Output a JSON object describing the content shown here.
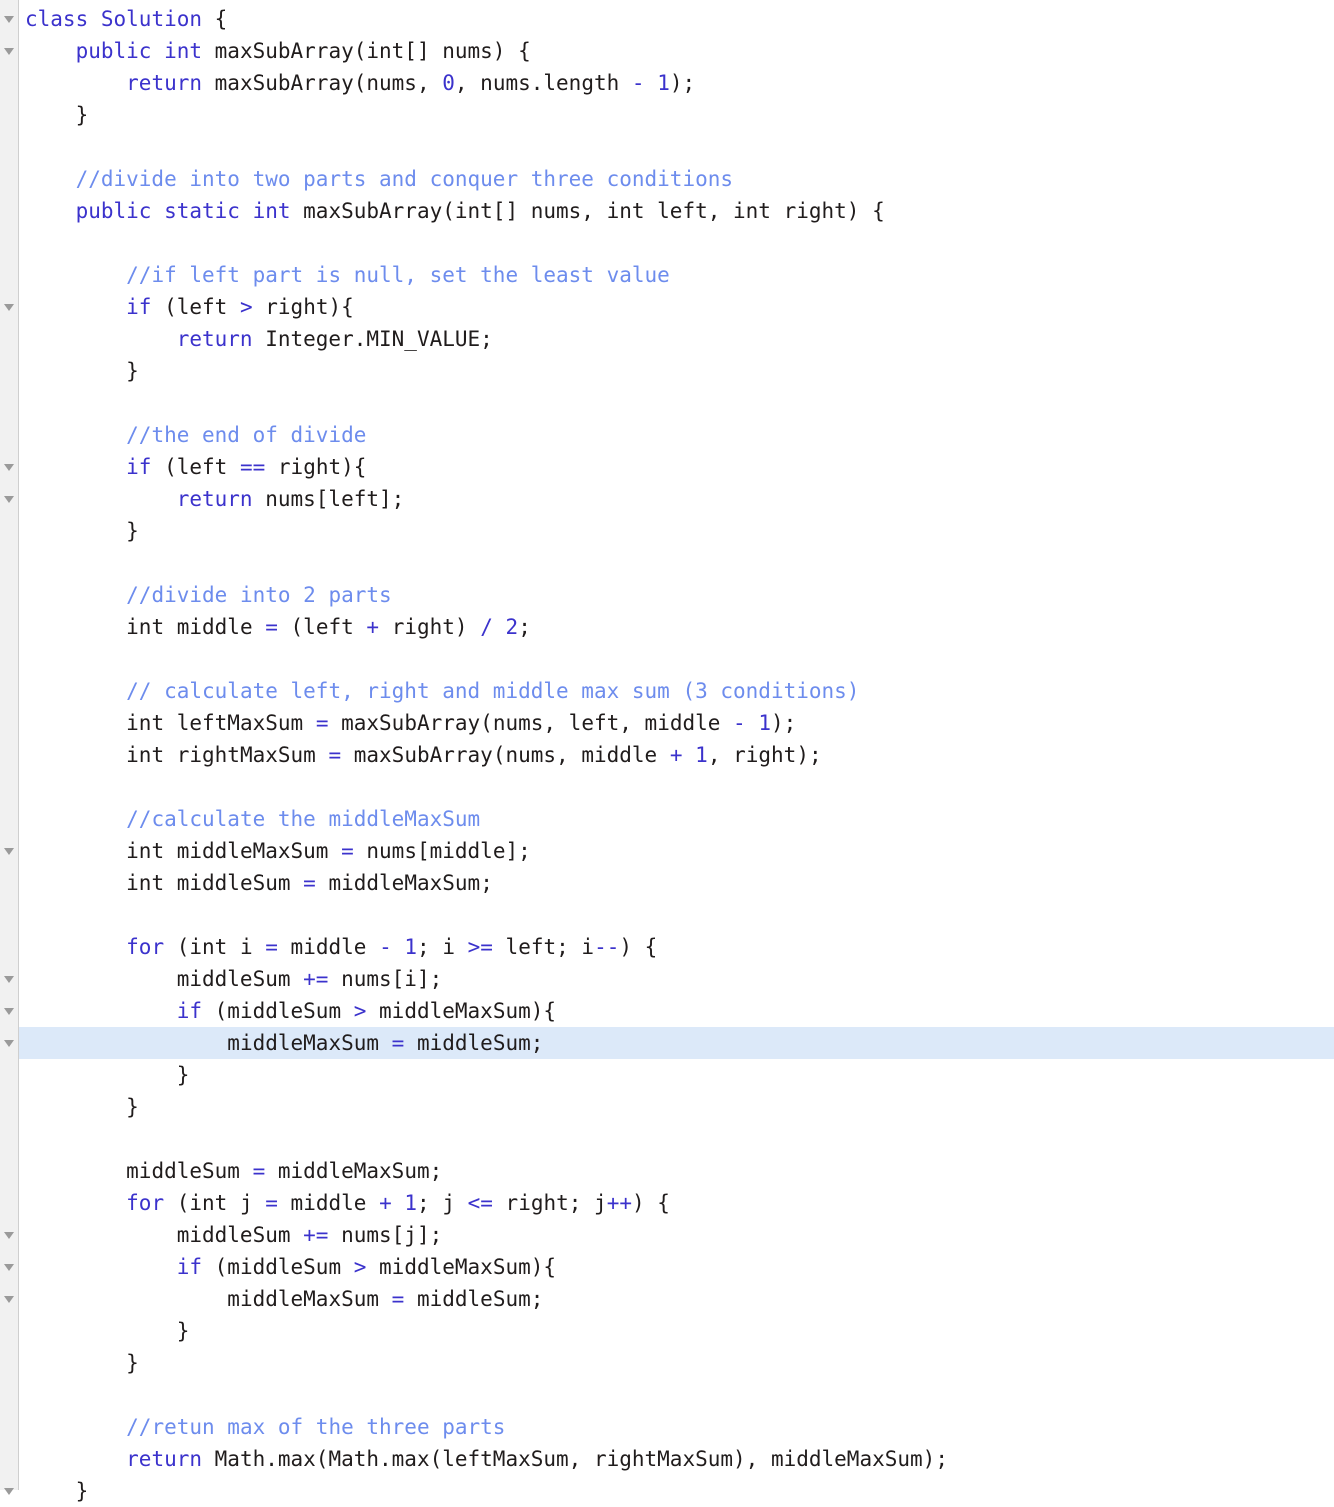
{
  "editor": {
    "language": "java",
    "gutter_label": "code-folding-gutter",
    "highlighted_line_index": 32,
    "line_height_px": 32,
    "colors": {
      "background": "#ffffff",
      "gutter_background": "#f1f1f1",
      "gutter_separator": "#cfcfcf",
      "keyword": "#3b32cc",
      "comment": "#6d8ced",
      "plain": "#201c1c",
      "operator": "#3b32cc",
      "number": "#3b32cc",
      "current_line_highlight": "#dce9f9",
      "fold_arrow": "#9a9a9a"
    },
    "fold_arrow_lines": [
      0,
      1,
      9,
      14,
      15,
      26,
      30,
      31,
      32,
      38,
      39,
      40,
      46
    ],
    "lines": [
      {
        "indent": 0,
        "tokens": [
          {
            "t": "kw",
            "v": "class"
          },
          {
            "t": "pl",
            "v": " "
          },
          {
            "t": "kw",
            "v": "Solution"
          },
          {
            "t": "pl",
            "v": " {"
          }
        ]
      },
      {
        "indent": 1,
        "tokens": [
          {
            "t": "kw",
            "v": "public int"
          },
          {
            "t": "pl",
            "v": " maxSubArray(int[] nums) {"
          }
        ]
      },
      {
        "indent": 2,
        "tokens": [
          {
            "t": "kw",
            "v": "return"
          },
          {
            "t": "pl",
            "v": " maxSubArray(nums, "
          },
          {
            "t": "num",
            "v": "0"
          },
          {
            "t": "pl",
            "v": ", nums.length "
          },
          {
            "t": "op",
            "v": "-"
          },
          {
            "t": "pl",
            "v": " "
          },
          {
            "t": "num",
            "v": "1"
          },
          {
            "t": "pl",
            "v": ");"
          }
        ]
      },
      {
        "indent": 1,
        "tokens": [
          {
            "t": "pl",
            "v": "}"
          }
        ]
      },
      {
        "indent": 0,
        "tokens": []
      },
      {
        "indent": 1,
        "tokens": [
          {
            "t": "cmt",
            "v": "//divide into two parts and conquer three conditions"
          }
        ]
      },
      {
        "indent": 1,
        "tokens": [
          {
            "t": "kw",
            "v": "public static int"
          },
          {
            "t": "pl",
            "v": " maxSubArray(int[] nums, int left, int right) {"
          }
        ]
      },
      {
        "indent": 0,
        "tokens": []
      },
      {
        "indent": 2,
        "tokens": [
          {
            "t": "cmt",
            "v": "//if left part is null, set the least value"
          }
        ]
      },
      {
        "indent": 2,
        "tokens": [
          {
            "t": "kw",
            "v": "if"
          },
          {
            "t": "pl",
            "v": " (left "
          },
          {
            "t": "op",
            "v": ">"
          },
          {
            "t": "pl",
            "v": " right){"
          }
        ]
      },
      {
        "indent": 3,
        "tokens": [
          {
            "t": "kw",
            "v": "return"
          },
          {
            "t": "pl",
            "v": " Integer.MIN_VALUE;"
          }
        ]
      },
      {
        "indent": 2,
        "tokens": [
          {
            "t": "pl",
            "v": "}"
          }
        ]
      },
      {
        "indent": 0,
        "tokens": []
      },
      {
        "indent": 2,
        "tokens": [
          {
            "t": "cmt",
            "v": "//the end of divide"
          }
        ]
      },
      {
        "indent": 2,
        "tokens": [
          {
            "t": "kw",
            "v": "if"
          },
          {
            "t": "pl",
            "v": " (left "
          },
          {
            "t": "op",
            "v": "=="
          },
          {
            "t": "pl",
            "v": " right){"
          }
        ]
      },
      {
        "indent": 3,
        "tokens": [
          {
            "t": "kw",
            "v": "return"
          },
          {
            "t": "pl",
            "v": " nums[left];"
          }
        ]
      },
      {
        "indent": 2,
        "tokens": [
          {
            "t": "pl",
            "v": "}"
          }
        ]
      },
      {
        "indent": 0,
        "tokens": []
      },
      {
        "indent": 2,
        "tokens": [
          {
            "t": "cmt",
            "v": "//divide into 2 parts"
          }
        ]
      },
      {
        "indent": 2,
        "tokens": [
          {
            "t": "pl",
            "v": "int middle "
          },
          {
            "t": "op",
            "v": "="
          },
          {
            "t": "pl",
            "v": " (left "
          },
          {
            "t": "op",
            "v": "+"
          },
          {
            "t": "pl",
            "v": " right) "
          },
          {
            "t": "op",
            "v": "/"
          },
          {
            "t": "pl",
            "v": " "
          },
          {
            "t": "num",
            "v": "2"
          },
          {
            "t": "pl",
            "v": ";"
          }
        ]
      },
      {
        "indent": 0,
        "tokens": []
      },
      {
        "indent": 2,
        "tokens": [
          {
            "t": "cmt",
            "v": "// calculate left, right and middle max sum (3 conditions)"
          }
        ]
      },
      {
        "indent": 2,
        "tokens": [
          {
            "t": "pl",
            "v": "int leftMaxSum "
          },
          {
            "t": "op",
            "v": "="
          },
          {
            "t": "pl",
            "v": " maxSubArray(nums, left, middle "
          },
          {
            "t": "op",
            "v": "-"
          },
          {
            "t": "pl",
            "v": " "
          },
          {
            "t": "num",
            "v": "1"
          },
          {
            "t": "pl",
            "v": ");"
          }
        ]
      },
      {
        "indent": 2,
        "tokens": [
          {
            "t": "pl",
            "v": "int rightMaxSum "
          },
          {
            "t": "op",
            "v": "="
          },
          {
            "t": "pl",
            "v": " maxSubArray(nums, middle "
          },
          {
            "t": "op",
            "v": "+"
          },
          {
            "t": "pl",
            "v": " "
          },
          {
            "t": "num",
            "v": "1"
          },
          {
            "t": "pl",
            "v": ", right);"
          }
        ]
      },
      {
        "indent": 0,
        "tokens": []
      },
      {
        "indent": 2,
        "tokens": [
          {
            "t": "cmt",
            "v": "//calculate the middleMaxSum"
          }
        ]
      },
      {
        "indent": 2,
        "tokens": [
          {
            "t": "pl",
            "v": "int middleMaxSum "
          },
          {
            "t": "op",
            "v": "="
          },
          {
            "t": "pl",
            "v": " nums[middle];"
          }
        ]
      },
      {
        "indent": 2,
        "tokens": [
          {
            "t": "pl",
            "v": "int middleSum "
          },
          {
            "t": "op",
            "v": "="
          },
          {
            "t": "pl",
            "v": " middleMaxSum;"
          }
        ]
      },
      {
        "indent": 0,
        "tokens": []
      },
      {
        "indent": 2,
        "tokens": [
          {
            "t": "kw",
            "v": "for"
          },
          {
            "t": "pl",
            "v": " (int i "
          },
          {
            "t": "op",
            "v": "="
          },
          {
            "t": "pl",
            "v": " middle "
          },
          {
            "t": "op",
            "v": "-"
          },
          {
            "t": "pl",
            "v": " "
          },
          {
            "t": "num",
            "v": "1"
          },
          {
            "t": "pl",
            "v": "; i "
          },
          {
            "t": "op",
            "v": ">="
          },
          {
            "t": "pl",
            "v": " left; i"
          },
          {
            "t": "op",
            "v": "--"
          },
          {
            "t": "pl",
            "v": ") {"
          }
        ]
      },
      {
        "indent": 3,
        "tokens": [
          {
            "t": "pl",
            "v": "middleSum "
          },
          {
            "t": "op",
            "v": "+="
          },
          {
            "t": "pl",
            "v": " nums[i];"
          }
        ]
      },
      {
        "indent": 3,
        "tokens": [
          {
            "t": "kw",
            "v": "if"
          },
          {
            "t": "pl",
            "v": " (middleSum "
          },
          {
            "t": "op",
            "v": ">"
          },
          {
            "t": "pl",
            "v": " middleMaxSum){"
          }
        ]
      },
      {
        "indent": 4,
        "tokens": [
          {
            "t": "pl",
            "v": "middleMaxSum "
          },
          {
            "t": "op",
            "v": "="
          },
          {
            "t": "pl",
            "v": " middleSum;"
          }
        ]
      },
      {
        "indent": 3,
        "tokens": [
          {
            "t": "pl",
            "v": "}"
          }
        ]
      },
      {
        "indent": 2,
        "tokens": [
          {
            "t": "pl",
            "v": "}"
          }
        ]
      },
      {
        "indent": 0,
        "tokens": []
      },
      {
        "indent": 2,
        "tokens": [
          {
            "t": "pl",
            "v": "middleSum "
          },
          {
            "t": "op",
            "v": "="
          },
          {
            "t": "pl",
            "v": " middleMaxSum;"
          }
        ]
      },
      {
        "indent": 2,
        "tokens": [
          {
            "t": "kw",
            "v": "for"
          },
          {
            "t": "pl",
            "v": " (int j "
          },
          {
            "t": "op",
            "v": "="
          },
          {
            "t": "pl",
            "v": " middle "
          },
          {
            "t": "op",
            "v": "+"
          },
          {
            "t": "pl",
            "v": " "
          },
          {
            "t": "num",
            "v": "1"
          },
          {
            "t": "pl",
            "v": "; j "
          },
          {
            "t": "op",
            "v": "<="
          },
          {
            "t": "pl",
            "v": " right; j"
          },
          {
            "t": "op",
            "v": "++"
          },
          {
            "t": "pl",
            "v": ") {"
          }
        ]
      },
      {
        "indent": 3,
        "tokens": [
          {
            "t": "pl",
            "v": "middleSum "
          },
          {
            "t": "op",
            "v": "+="
          },
          {
            "t": "pl",
            "v": " nums[j];"
          }
        ]
      },
      {
        "indent": 3,
        "tokens": [
          {
            "t": "kw",
            "v": "if"
          },
          {
            "t": "pl",
            "v": " (middleSum "
          },
          {
            "t": "op",
            "v": ">"
          },
          {
            "t": "pl",
            "v": " middleMaxSum){"
          }
        ]
      },
      {
        "indent": 4,
        "tokens": [
          {
            "t": "pl",
            "v": "middleMaxSum "
          },
          {
            "t": "op",
            "v": "="
          },
          {
            "t": "pl",
            "v": " middleSum;"
          }
        ]
      },
      {
        "indent": 3,
        "tokens": [
          {
            "t": "pl",
            "v": "}"
          }
        ]
      },
      {
        "indent": 2,
        "tokens": [
          {
            "t": "pl",
            "v": "}"
          }
        ]
      },
      {
        "indent": 0,
        "tokens": []
      },
      {
        "indent": 2,
        "tokens": [
          {
            "t": "cmt",
            "v": "//retun max of the three parts"
          }
        ]
      },
      {
        "indent": 2,
        "tokens": [
          {
            "t": "kw",
            "v": "return"
          },
          {
            "t": "pl",
            "v": " Math.max(Math.max(leftMaxSum, rightMaxSum), middleMaxSum);"
          }
        ]
      },
      {
        "indent": 1,
        "tokens": [
          {
            "t": "pl",
            "v": "}"
          }
        ]
      }
    ]
  }
}
